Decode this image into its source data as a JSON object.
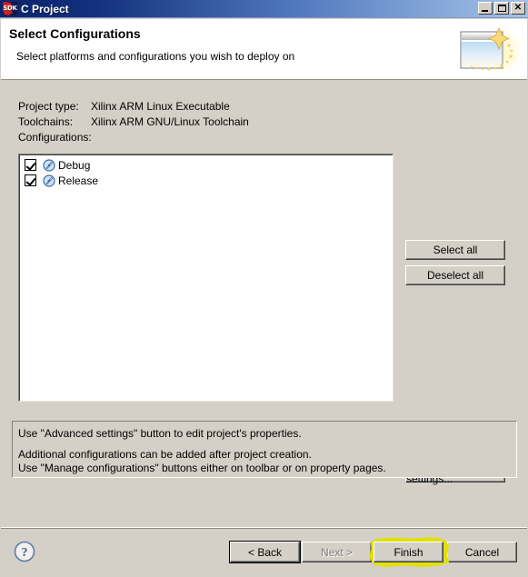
{
  "window": {
    "title": "C Project",
    "app_icon": "sdk-icon",
    "icon_text": "SDK",
    "controls": [
      {
        "name": "minimize-button",
        "glyph": "_"
      },
      {
        "name": "maximize-button",
        "glyph": "□"
      },
      {
        "name": "close-button",
        "glyph": "✕"
      }
    ],
    "titlebar_color_start": "#0a246a",
    "titlebar_color_end": "#a6c0e4"
  },
  "header": {
    "title": "Select Configurations",
    "subtitle": "Select platforms and configurations you wish to deploy on",
    "banner_icon": "wizard-window-sparkle-icon"
  },
  "project_info": [
    {
      "label": "Project type:",
      "value": "Xilinx ARM Linux Executable"
    },
    {
      "label": "Toolchains:",
      "value": "Xilinx ARM GNU/Linux Toolchain"
    },
    {
      "label": "Configurations:",
      "value": ""
    }
  ],
  "configurations": {
    "items": [
      {
        "label": "Debug",
        "checked": true,
        "icon": "configuration-gauge-icon"
      },
      {
        "label": "Release",
        "checked": true,
        "icon": "configuration-gauge-icon"
      }
    ]
  },
  "side_buttons": {
    "select_all": "Select all",
    "deselect_all": "Deselect all",
    "advanced_settings": "Advanced settings..."
  },
  "info_panel": {
    "line1": "Use \"Advanced settings\" button to edit project's properties.",
    "line2": "Additional configurations can be added after project creation.",
    "line3": "Use \"Manage configurations\" buttons either on toolbar or on property pages."
  },
  "footer": {
    "help_icon": "help-question-icon",
    "back": "< Back",
    "next": "Next >",
    "finish": "Finish",
    "cancel": "Cancel",
    "next_disabled": true,
    "highlight_color": "#e3e000"
  }
}
